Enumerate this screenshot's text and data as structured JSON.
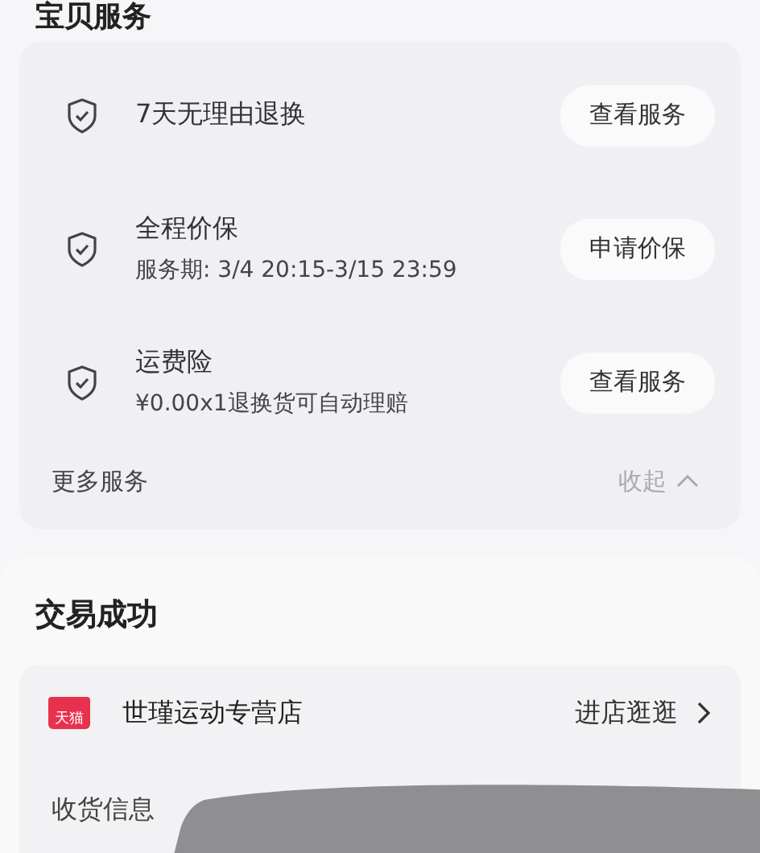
{
  "section_title": "宝贝服务",
  "services": [
    {
      "title": "7天无理由退换",
      "button": "查看服务"
    },
    {
      "title": "全程价保",
      "detail": "服务期: 3/4 20:15-3/15 23:59",
      "button": "申请价保"
    },
    {
      "title": "运费险",
      "detail": "¥0.00x1退换货可自动理赔",
      "button": "查看服务"
    }
  ],
  "more": {
    "label": "更多服务",
    "toggle": "收起",
    "expanded": true
  },
  "order": {
    "status": "交易成功",
    "store_badge": "天猫",
    "store_name": "世瑾运动专营店",
    "store_link": "进店逛逛",
    "shipping_label": "收货信息"
  }
}
